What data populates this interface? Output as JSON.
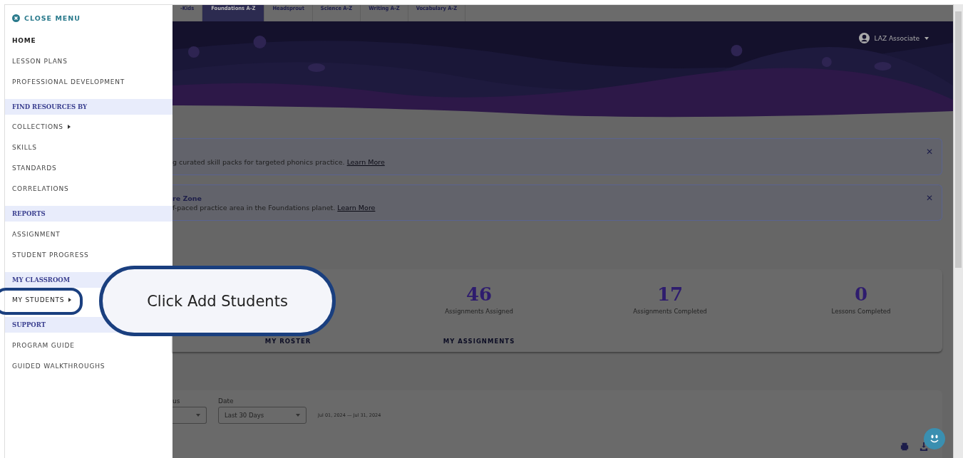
{
  "menu": {
    "close_label": "CLOSE MENU",
    "items": [
      {
        "kind": "link",
        "label": "HOME",
        "active": true
      },
      {
        "kind": "link",
        "label": "LESSON PLANS",
        "active": false
      },
      {
        "kind": "link",
        "label": "PROFESSIONAL DEVELOPMENT",
        "active": false
      },
      {
        "kind": "heading",
        "label": "FIND RESOURCES BY"
      },
      {
        "kind": "submenu",
        "label": "COLLECTIONS",
        "highlighted": false
      },
      {
        "kind": "link",
        "label": "SKILLS",
        "active": false
      },
      {
        "kind": "link",
        "label": "STANDARDS",
        "active": false
      },
      {
        "kind": "link",
        "label": "CORRELATIONS",
        "active": false
      },
      {
        "kind": "heading",
        "label": "REPORTS"
      },
      {
        "kind": "link",
        "label": "ASSIGNMENT",
        "active": false
      },
      {
        "kind": "link",
        "label": "STUDENT PROGRESS",
        "active": false
      },
      {
        "kind": "heading",
        "label": "MY CLASSROOM"
      },
      {
        "kind": "submenu",
        "label": "MY STUDENTS",
        "highlighted": true
      },
      {
        "kind": "heading",
        "label": "SUPPORT"
      },
      {
        "kind": "link",
        "label": "PROGRAM GUIDE",
        "active": false
      },
      {
        "kind": "link",
        "label": "GUIDED WALKTHROUGHS",
        "active": false
      }
    ]
  },
  "tabs": [
    {
      "label": "-Kids",
      "selected": false
    },
    {
      "label": "Foundations A-Z",
      "selected": true
    },
    {
      "label": "Headsprout",
      "selected": false
    },
    {
      "label": "Science A-Z",
      "selected": false
    },
    {
      "label": "Writing A-Z",
      "selected": false
    },
    {
      "label": "Vocabulary A-Z",
      "selected": false
    }
  ],
  "user": {
    "name": "LAZ Associate"
  },
  "banners": [
    {
      "text": "g curated skill packs for targeted phonics practice.",
      "link": "Learn More",
      "close": "✕"
    },
    {
      "title": "re Zone",
      "text": "f-paced practice area in the Foundations planet.",
      "link": "Learn More",
      "close": "✕"
    }
  ],
  "stats": [
    {
      "value": "46",
      "label": "Assignments Assigned"
    },
    {
      "value": "17",
      "label": "Assignments Completed"
    },
    {
      "value": "0",
      "label": "Lessons Completed"
    }
  ],
  "stat_links": [
    "MY ROSTER",
    "MY ASSIGNMENTS"
  ],
  "filters": {
    "status_label": "us",
    "date_label": "Date",
    "date_value": "Last 30 Days",
    "range": "Jul 01, 2024 — Jul 31, 2024"
  },
  "callout": {
    "text": "Click Add Students"
  }
}
